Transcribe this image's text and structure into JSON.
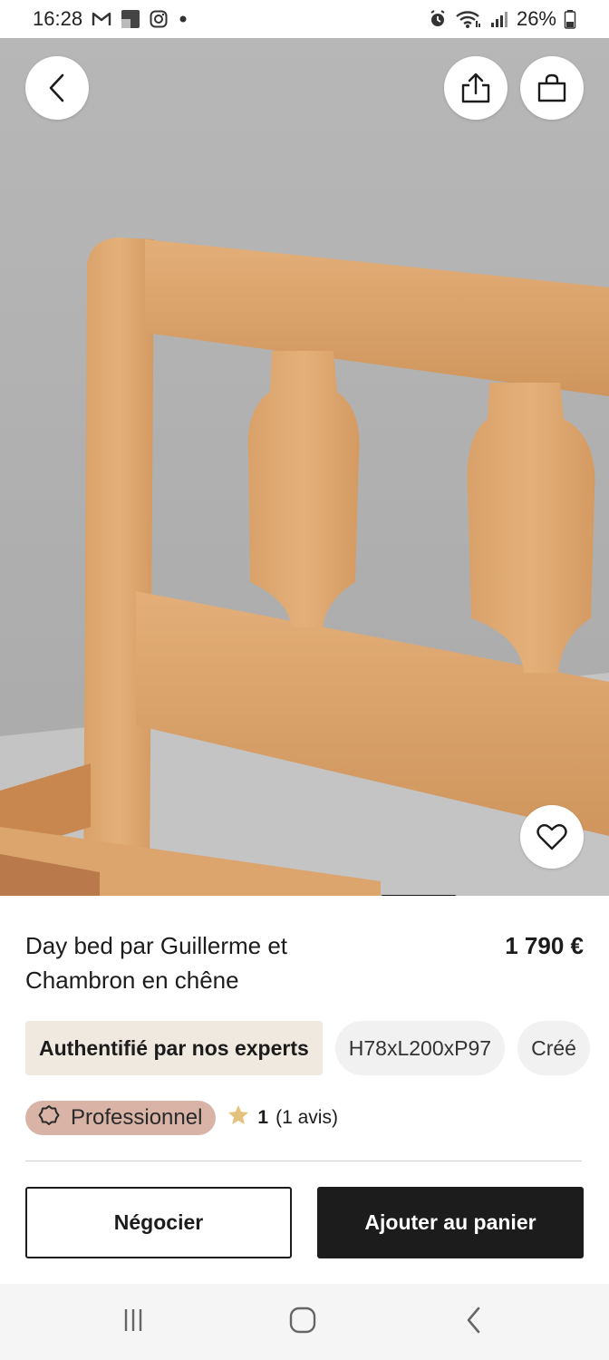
{
  "status_bar": {
    "time": "16:28",
    "battery": "26%",
    "notification_icons": [
      "gmail-icon",
      "app-icon",
      "instagram-icon",
      "dot-icon"
    ],
    "system_icons": [
      "alarm-icon",
      "wifi-icon",
      "signal-icon",
      "battery-icon"
    ]
  },
  "header": {
    "back_icon": "chevron-left-icon",
    "share_icon": "share-icon",
    "cart_icon": "shopping-bag-icon"
  },
  "hero": {
    "favorite_icon": "heart-icon",
    "pager_active": 1
  },
  "product": {
    "title": "Day bed par Guillerme et Chambron en chêne",
    "price": "1 790 €"
  },
  "chips": [
    {
      "label": "Authentifié par nos experts"
    },
    {
      "label": "H78xL200xP97"
    },
    {
      "label": "Créé"
    }
  ],
  "seller": {
    "badge_label": "Professionnel",
    "rating_value": "1",
    "rating_count": "(1 avis)"
  },
  "actions": {
    "negotiate_label": "Négocier",
    "add_to_cart_label": "Ajouter au panier"
  },
  "colors": {
    "primary": "#1c1c1c",
    "auth_chip_bg": "#efe9df",
    "pro_badge_bg": "#d8b3a6",
    "star": "#e3c27d"
  }
}
